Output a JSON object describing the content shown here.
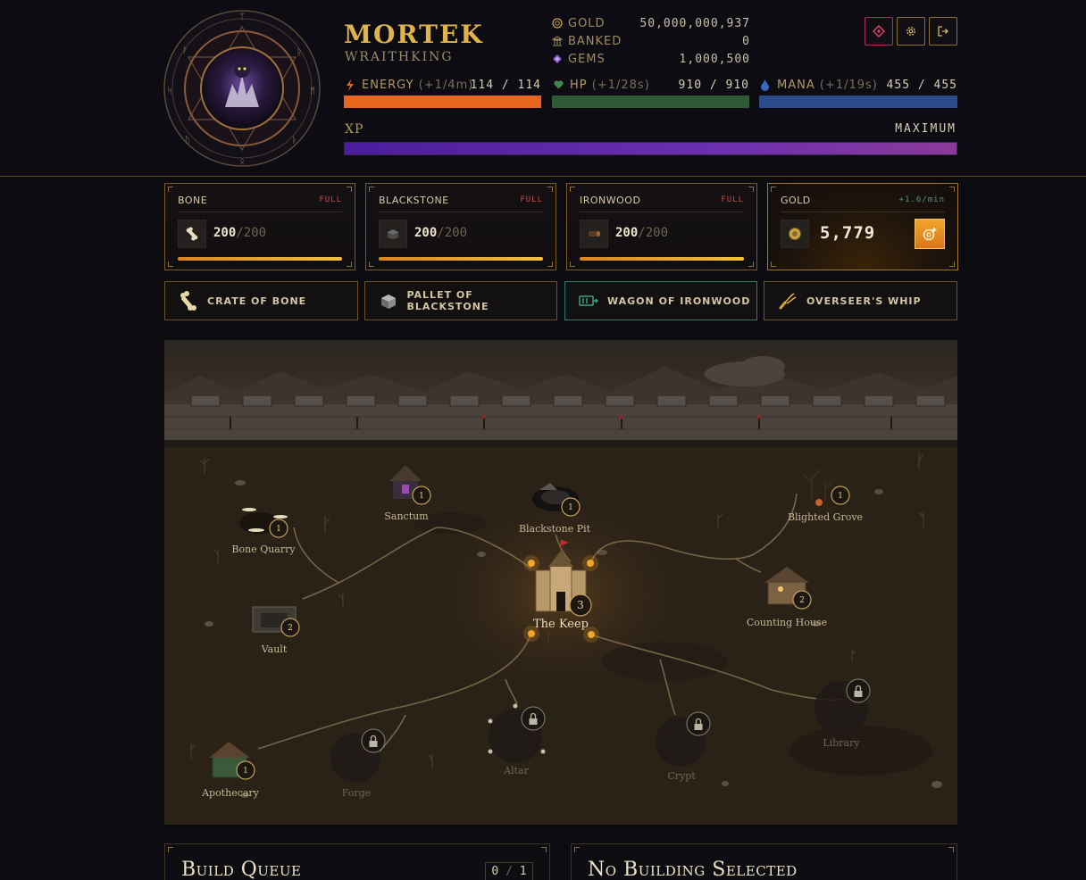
{
  "player": {
    "name": "MORTEK",
    "title": "WRAITHKING"
  },
  "currencies": {
    "gold": {
      "label": "GOLD",
      "value": "50,000,000,937"
    },
    "banked": {
      "label": "BANKED",
      "value": "0"
    },
    "gems": {
      "label": "GEMS",
      "value": "1,000,500"
    }
  },
  "stats": {
    "energy": {
      "label": "ENERGY",
      "rate": "(+1/4m)",
      "value": "114 / 114",
      "fill": 1.0,
      "color": "#e8651e"
    },
    "hp": {
      "label": "HP",
      "rate": "(+1/28s)",
      "value": "910 / 910",
      "fill": 1.0,
      "color": "#2f5a35"
    },
    "mana": {
      "label": "MANA",
      "rate": "(+1/19s)",
      "value": "455 / 455",
      "fill": 1.0,
      "color": "#2a4a8a"
    }
  },
  "xp": {
    "label": "XP",
    "value": "MAXIMUM",
    "fill": 1.0
  },
  "header_buttons": [
    "diamond-icon",
    "gear-icon",
    "logout-icon"
  ],
  "resources": [
    {
      "name": "BONE",
      "tag": "FULL",
      "amount": "200",
      "max": "/200",
      "fill": 1.0,
      "icon": "bone-icon"
    },
    {
      "name": "BLACKSTONE",
      "tag": "FULL",
      "amount": "200",
      "max": "/200",
      "fill": 1.0,
      "icon": "stone-icon"
    },
    {
      "name": "IRONWOOD",
      "tag": "FULL",
      "amount": "200",
      "max": "/200",
      "fill": 1.0,
      "icon": "log-icon"
    }
  ],
  "gold_card": {
    "name": "GOLD",
    "rate": "+1.6/min",
    "amount": "5,779",
    "icon": "coin-icon",
    "button_icon": "add-coin-icon"
  },
  "items": [
    {
      "label": "CRATE OF BONE",
      "icon": "bone-crate-icon"
    },
    {
      "label": "PALLET OF BLACKSTONE",
      "icon": "stone-pallet-icon"
    },
    {
      "label": "WAGON OF IRONWOOD",
      "icon": "wagon-icon"
    },
    {
      "label": "OVERSEER'S WHIP",
      "icon": "whip-icon"
    }
  ],
  "map": {
    "buildings": [
      {
        "id": "bone-quarry",
        "label": "Bone Quarry",
        "level": "1",
        "locked": false
      },
      {
        "id": "sanctum",
        "label": "Sanctum",
        "level": "1",
        "locked": false
      },
      {
        "id": "blackstone-pit",
        "label": "Blackstone Pit",
        "level": "1",
        "locked": false
      },
      {
        "id": "blighted-grove",
        "label": "Blighted Grove",
        "level": "1",
        "locked": false
      },
      {
        "id": "the-keep",
        "label": "The Keep",
        "level": "3",
        "locked": false
      },
      {
        "id": "counting-house",
        "label": "Counting House",
        "level": "2",
        "locked": false
      },
      {
        "id": "vault",
        "label": "Vault",
        "level": "2",
        "locked": false
      },
      {
        "id": "apothecary",
        "label": "Apothecary",
        "level": "1",
        "locked": false
      },
      {
        "id": "forge",
        "label": "Forge",
        "level": "",
        "locked": true
      },
      {
        "id": "altar",
        "label": "Altar",
        "level": "",
        "locked": true
      },
      {
        "id": "crypt",
        "label": "Crypt",
        "level": "",
        "locked": true
      },
      {
        "id": "library",
        "label": "Library",
        "level": "",
        "locked": true
      }
    ]
  },
  "build_queue": {
    "title": "Build Queue",
    "used": "0",
    "sep": "/",
    "total": "1"
  },
  "selection_panel": {
    "title": "No Building Selected"
  }
}
